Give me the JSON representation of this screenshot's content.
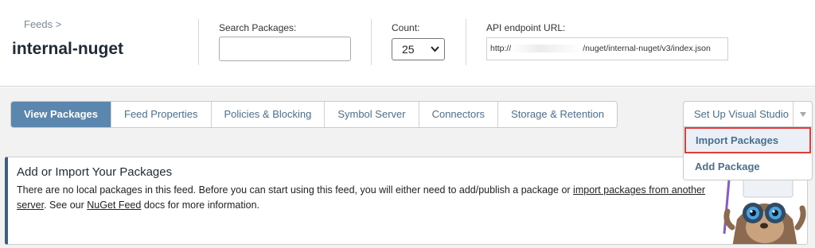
{
  "breadcrumb": "Feeds >",
  "feed_name": "internal-nuget",
  "search": {
    "label": "Search Packages:",
    "value": ""
  },
  "count": {
    "label": "Count:",
    "selected": "25"
  },
  "api": {
    "label": "API endpoint URL:",
    "prefix": "http://",
    "suffix": "/nuget/internal-nuget/v3/index.json"
  },
  "tabs": [
    {
      "label": "View Packages",
      "active": true
    },
    {
      "label": "Feed Properties"
    },
    {
      "label": "Policies & Blocking"
    },
    {
      "label": "Symbol Server"
    },
    {
      "label": "Connectors"
    },
    {
      "label": "Storage & Retention"
    }
  ],
  "setup_button": "Set Up Visual Studio",
  "dropdown": {
    "items": [
      {
        "label": "Import Packages"
      },
      {
        "label": "Add Package"
      }
    ]
  },
  "panel": {
    "title": "Add or Import Your Packages",
    "text_1": "There are no local packages in this feed. Before you can start using this feed, you will either need to add/publish a package or ",
    "link_1": "import packages from another server",
    "text_2": ". See our ",
    "link_2": "NuGet Feed",
    "text_3": " docs for more information."
  },
  "colors": {
    "accent": "#5b86ad",
    "highlight_border": "#e03c3c",
    "panel_border": "#3e5f7d"
  }
}
